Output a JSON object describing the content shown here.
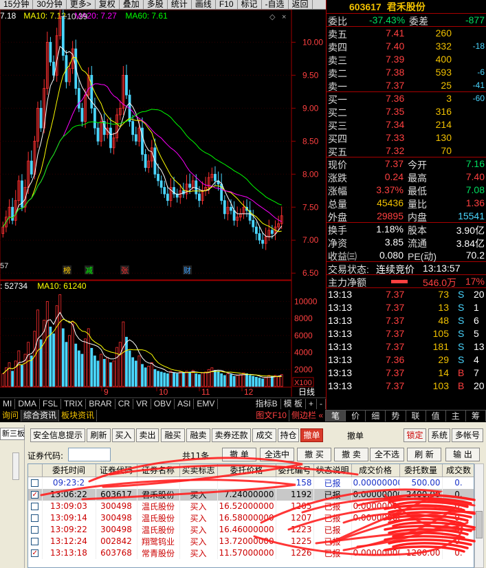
{
  "toolbar": [
    "15分钟",
    "30分钟",
    "更多>",
    "复权",
    "叠加",
    "多股",
    "统计",
    "画线",
    "F10",
    "标记",
    "-自选",
    "返回"
  ],
  "chart": {
    "ma_legend": [
      {
        "text": "7.18",
        "color": "#ffffff"
      },
      {
        "text": "MA10: 7.12",
        "color": "#ffff00"
      },
      {
        "text": "MA20: 7.27",
        "color": "#ff00ff"
      },
      {
        "text": "MA60: 7.61",
        "color": "#00ff00"
      }
    ],
    "peak_label": "10.39",
    "low_label": "57",
    "price_axis": [
      "10.00",
      "9.50",
      "9.00",
      "8.50",
      "8.00",
      "7.50",
      "7.00",
      "6.50"
    ],
    "event_markers": [
      {
        "text": "榜",
        "color": "#ffcc00"
      },
      {
        "text": "减",
        "color": "#00ff00"
      },
      {
        "text": "张",
        "color": "#ff3030"
      },
      {
        "text": "财",
        "color": "#3aa0ff"
      }
    ],
    "volume_legend": [
      {
        "text": ": 52734",
        "color": "#ffffff"
      },
      {
        "text": "MA10: 61240",
        "color": "#ffff00"
      }
    ],
    "volume_axis": [
      "10000",
      "8000",
      "6000",
      "4000",
      "2000",
      "X100"
    ],
    "x_axis": [
      "9",
      "10",
      "11",
      "12"
    ],
    "right_label": "日线"
  },
  "bottom_tabs": [
    "MI",
    "DMA",
    "FSL",
    "TRIX",
    "BRAR",
    "CR",
    "VR",
    "OBV",
    "ASI",
    "EMV"
  ],
  "bottom_tabs_right": [
    "指标B",
    "模 板",
    "+",
    "-"
  ],
  "info_tabs": [
    "询问",
    "综合资讯",
    "板块资讯"
  ],
  "info_tabs_right": [
    "图文F10",
    "侧边栏 «"
  ],
  "quote": {
    "code": "603617",
    "name": "君禾股份",
    "webi_label": "委比",
    "webi_value": "-37.43%",
    "weicha_label": "委差",
    "weicha_value": "-877",
    "asks": [
      {
        "label": "卖五",
        "price": "7.41",
        "vol": "260",
        "chg": ""
      },
      {
        "label": "卖四",
        "price": "7.40",
        "vol": "332",
        "chg": "-18"
      },
      {
        "label": "卖三",
        "price": "7.39",
        "vol": "400",
        "chg": ""
      },
      {
        "label": "卖二",
        "price": "7.38",
        "vol": "593",
        "chg": "-6"
      },
      {
        "label": "卖一",
        "price": "7.37",
        "vol": "25",
        "chg": "-41"
      }
    ],
    "bids": [
      {
        "label": "买一",
        "price": "7.36",
        "vol": "3",
        "chg": "-60"
      },
      {
        "label": "买二",
        "price": "7.35",
        "vol": "316",
        "chg": ""
      },
      {
        "label": "买三",
        "price": "7.34",
        "vol": "214",
        "chg": ""
      },
      {
        "label": "买四",
        "price": "7.33",
        "vol": "130",
        "chg": ""
      },
      {
        "label": "买五",
        "price": "7.32",
        "vol": "70",
        "chg": ""
      }
    ],
    "stats": [
      {
        "l1": "现价",
        "v1": "7.37",
        "c1": "red",
        "l2": "今开",
        "v2": "7.16",
        "c2": "green"
      },
      {
        "l1": "涨跌",
        "v1": "0.24",
        "c1": "red",
        "l2": "最高",
        "v2": "7.40",
        "c2": "red"
      },
      {
        "l1": "涨幅",
        "v1": "3.37%",
        "c1": "red",
        "l2": "最低",
        "v2": "7.08",
        "c2": "green"
      },
      {
        "l1": "总量",
        "v1": "45436",
        "c1": "yellow",
        "l2": "量比",
        "v2": "1.36",
        "c2": "red"
      },
      {
        "l1": "外盘",
        "v1": "29895",
        "c1": "red",
        "l2": "内盘",
        "v2": "15541",
        "c2": "cyan"
      }
    ],
    "stats2": [
      {
        "l1": "换手",
        "v1": "1.18%",
        "c1": "white",
        "l2": "股本",
        "v2": "3.90亿",
        "c2": "white"
      },
      {
        "l1": "净资",
        "v1": "3.85",
        "c1": "white",
        "l2": "流通",
        "v2": "3.84亿",
        "c2": "white"
      },
      {
        "l1": "收益㈢",
        "v1": "0.080",
        "c1": "white",
        "l2": "PE(动)",
        "v2": "70.2",
        "c2": "white"
      }
    ],
    "trade_status_label": "交易状态:",
    "trade_status": "连续竞价",
    "trade_time": "13:13:57",
    "main_flow_label": "主力净额",
    "main_flow_value": "546.0万",
    "main_flow_pct": "17%",
    "ticks": [
      {
        "t": "13:13",
        "p": "7.37",
        "v": "73",
        "s": "S",
        "n": "20",
        "pc": "red",
        "sc": "cyan"
      },
      {
        "t": "13:13",
        "p": "7.37",
        "v": "13",
        "s": "S",
        "n": "1",
        "pc": "red",
        "sc": "cyan"
      },
      {
        "t": "13:13",
        "p": "7.37",
        "v": "48",
        "s": "S",
        "n": "6",
        "pc": "red",
        "sc": "cyan"
      },
      {
        "t": "13:13",
        "p": "7.37",
        "v": "105",
        "s": "S",
        "n": "5",
        "pc": "red",
        "sc": "cyan"
      },
      {
        "t": "13:13",
        "p": "7.37",
        "v": "181",
        "s": "S",
        "n": "13",
        "pc": "red",
        "sc": "cyan"
      },
      {
        "t": "13:13",
        "p": "7.36",
        "v": "29",
        "s": "S",
        "n": "4",
        "pc": "red",
        "sc": "cyan"
      },
      {
        "t": "13:13",
        "p": "7.37",
        "v": "14",
        "s": "B",
        "n": "7",
        "pc": "red",
        "sc": "red"
      },
      {
        "t": "13:13",
        "p": "7.37",
        "v": "103",
        "s": "B",
        "n": "20",
        "pc": "red",
        "sc": "red"
      }
    ]
  },
  "right_tabs": [
    "笔",
    "价",
    "细",
    "势",
    "联",
    "值",
    "主",
    "筹"
  ],
  "trade": {
    "side_tab": "新三板",
    "top_buttons": [
      "安全信息提示",
      "刷新",
      "买入",
      "卖出",
      "融买",
      "融卖",
      "卖券还款",
      "成交",
      "持仓",
      "撤单",
      "撤单",
      "锁定",
      "系统",
      "多帐号"
    ],
    "code_label": "证券代码:",
    "count": "共11条",
    "row2_buttons": [
      "撤 单",
      "全选中",
      "撤 买",
      "撤 卖",
      "全不选",
      "刷 新",
      "输 出"
    ],
    "columns": [
      "",
      "委托时间",
      "证券代码",
      "证券名称",
      "买卖标志",
      "委托价格",
      "委托编号",
      "状态说明",
      "成交价格",
      "委托数量",
      "成交数"
    ],
    "rows": [
      {
        "checked": false,
        "sel": false,
        "color": "c-blue",
        "time": "09:23:2",
        "code": "",
        "name": "",
        "side": "",
        "price": "",
        "no": "158",
        "status": "已报",
        "dprice": "0.00000000",
        "qty": "500.00",
        "dq": "0."
      },
      {
        "checked": true,
        "sel": true,
        "color": "c-dark",
        "time": "13:06:22",
        "code": "603617",
        "name": "君禾股份",
        "side": "买入",
        "price": "7.24000000",
        "no": "1192",
        "status": "已报",
        "dprice": "0.00000000",
        "qty": "2400.00",
        "dq": "0."
      },
      {
        "checked": false,
        "sel": false,
        "color": "c-red",
        "time": "13:09:03",
        "code": "300498",
        "name": "温氏股份",
        "side": "买入",
        "price": "16.52000000",
        "no": "1205",
        "status": "已报",
        "dprice": "0.00000000",
        "qty": "",
        "dq": "0."
      },
      {
        "checked": false,
        "sel": false,
        "color": "c-red",
        "time": "13:09:14",
        "code": "300498",
        "name": "温氏股份",
        "side": "买入",
        "price": "16.58000000",
        "no": "1207",
        "status": "已报",
        "dprice": "0.00000000",
        "qty": "",
        "dq": "0."
      },
      {
        "checked": false,
        "sel": false,
        "color": "c-red",
        "time": "13:09:22",
        "code": "300498",
        "name": "温氏股份",
        "side": "买入",
        "price": "16.46000000",
        "no": "1223",
        "status": "已报",
        "dprice": "",
        "qty": "",
        "dq": "0."
      },
      {
        "checked": false,
        "sel": false,
        "color": "c-red",
        "time": "13:12:24",
        "code": "002842",
        "name": "翔鹭钨业",
        "side": "买入",
        "price": "13.72000000",
        "no": "1225",
        "status": "已报",
        "dprice": "",
        "qty": "",
        "dq": "0."
      },
      {
        "checked": true,
        "sel": false,
        "color": "c-red",
        "time": "13:13:18",
        "code": "603768",
        "name": "常青股份",
        "side": "买入",
        "price": "11.57000000",
        "no": "1226",
        "status": "已报",
        "dprice": "0.00000000",
        "qty": "1200.00",
        "dq": "0."
      }
    ]
  },
  "colors": {
    "up": "#ff4040",
    "down": "#00e060",
    "ma10": "#ffff00",
    "ma20": "#ff00ff",
    "ma60": "#00ff00",
    "scribble": "#ff2020"
  }
}
